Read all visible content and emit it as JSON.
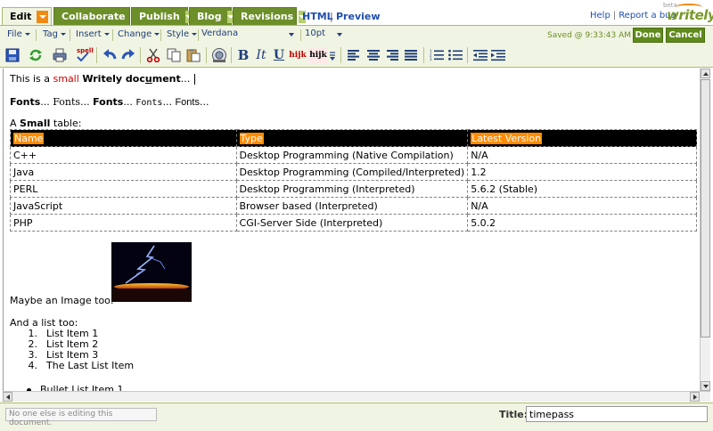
{
  "tabs": [
    {
      "label": "Edit",
      "active": true
    },
    {
      "label": "Collaborate",
      "active": false
    },
    {
      "label": "Publish",
      "active": false
    },
    {
      "label": "Blog",
      "active": false
    },
    {
      "label": "Revisions",
      "active": false
    }
  ],
  "modes": {
    "html": "HTML",
    "separator": "|",
    "preview": "Preview"
  },
  "top_links": {
    "help": "Help",
    "separator": "|",
    "report": "Report a bug"
  },
  "logo": {
    "beta": "beta",
    "word": "writely"
  },
  "menus": {
    "file": "File",
    "tag": "Tag",
    "insert": "Insert",
    "change": "Change",
    "style": "Style"
  },
  "font_select": {
    "value": "Verdana"
  },
  "size_select": {
    "value": "10pt"
  },
  "saved_status": "Saved @ 9:33:43 AM",
  "buttons": {
    "done": "Done",
    "cancel": "Cancel"
  },
  "toolbar": {
    "spell_label": "spell",
    "bold_label": "B",
    "italic_label": "It",
    "underline_label": "U",
    "fg_color_label": "hijk",
    "bg_color_label": "hijk"
  },
  "document": {
    "line1": {
      "prefix": "This is a ",
      "small": "small",
      "middle": " ",
      "bold": "Writely doc",
      "underline": "u",
      "bold_end": "ment",
      "suffix": "..."
    },
    "fonts_line": [
      {
        "text": "Fonts",
        "bold": true
      },
      {
        "text": "... ",
        "bold": false
      },
      {
        "text": "Fonts",
        "bold": false,
        "serif": true
      },
      {
        "text": "... ",
        "bold": false
      },
      {
        "text": "Fonts",
        "bold": true
      },
      {
        "text": "... ",
        "bold": false
      },
      {
        "text": "Fonts",
        "bold": false,
        "mono": true
      },
      {
        "text": "... ",
        "bold": false
      },
      {
        "text": "Fonts",
        "bold": false
      },
      {
        "text": "...",
        "bold": false
      }
    ],
    "table_caption": {
      "prefix": "A ",
      "bold": "Small",
      "suffix": " table:"
    },
    "table": {
      "headers": [
        "Name",
        "Type",
        "Latest Version"
      ],
      "rows": [
        [
          "C++",
          "Desktop Programming (Native Compilation)",
          "N/A"
        ],
        [
          "Java",
          "Desktop Programming (Compiled/Interpreted)",
          "1.2"
        ],
        [
          "PERL",
          "Desktop Programming (Interpreted)",
          "5.6.2 (Stable)"
        ],
        [
          "JavaScript",
          "Browser based (Interpreted)",
          "N/A"
        ],
        [
          "PHP",
          "CGI-Server Side (Interpreted)",
          "5.0.2"
        ]
      ]
    },
    "image_caption": "Maybe an Image too:",
    "list_caption": "And a list too:",
    "numbered_list": [
      "List Item 1",
      "List Item 2",
      "List Item 3",
      "The Last List Item"
    ],
    "bullet_list": [
      "Bullet List Item 1"
    ]
  },
  "footer": {
    "presence": "No one else is editing this document.",
    "title_label": "Title:",
    "title_value": "timepass"
  },
  "colors": {
    "accent_green": "#6d8f2a",
    "active_tab_dropdown": "#f08a12",
    "table_header_bg": "#000000",
    "table_header_highlight": "#ff8c00",
    "small_text_red": "#cc0000"
  }
}
